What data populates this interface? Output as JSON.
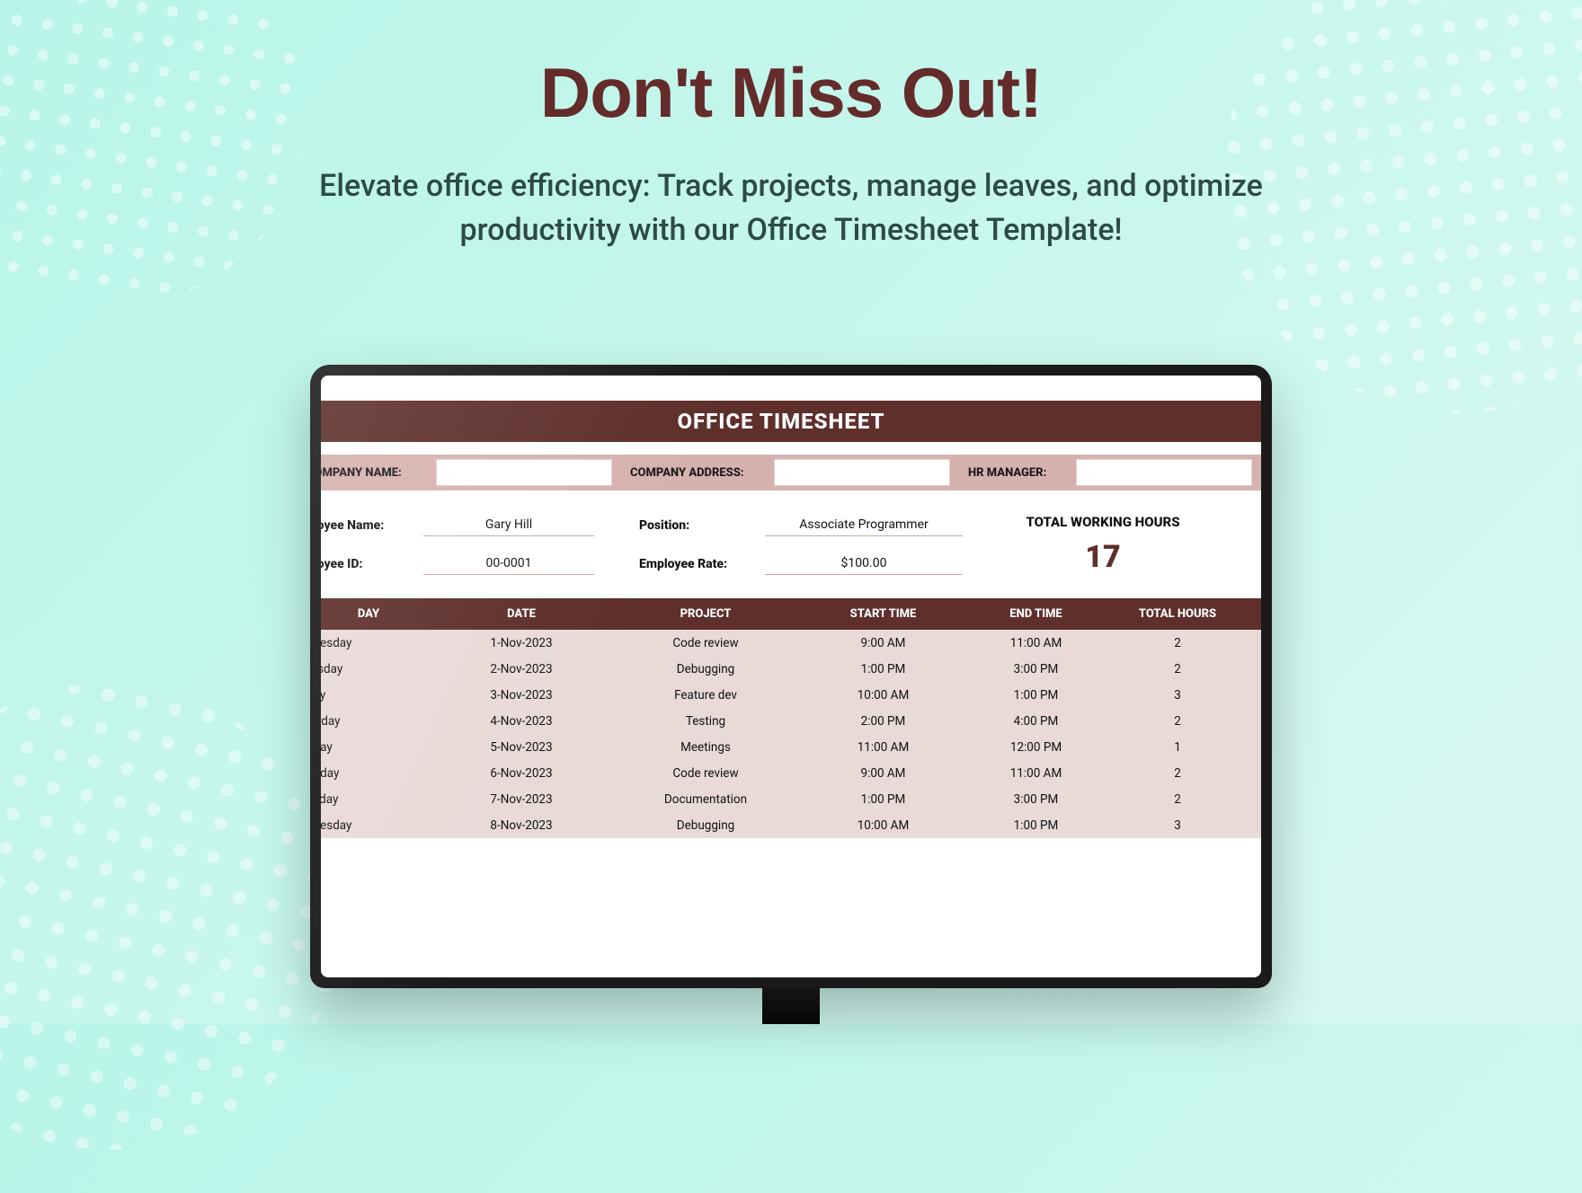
{
  "hero": {
    "headline": "Don't Miss Out!",
    "subhead": "Elevate office efficiency: Track projects, manage leaves, and optimize productivity with our Office Timesheet Template!"
  },
  "sheet": {
    "title": "OFFICE TIMESHEET",
    "meta": {
      "company_name_label": "COMPANY NAME:",
      "company_address_label": "COMPANY ADDRESS:",
      "hr_manager_label": "HR MANAGER:"
    },
    "employee": {
      "name_label": "ployee Name:",
      "name_value": "Gary Hill",
      "position_label": "Position:",
      "position_value": "Associate Programmer",
      "id_label": "ployee ID:",
      "id_value": "00-0001",
      "rate_label": "Employee Rate:",
      "rate_value": "$100.00",
      "twh_label": "TOTAL WORKING HOURS",
      "twh_value": "17"
    },
    "columns": {
      "day": "DAY",
      "date": "DATE",
      "project": "PROJECT",
      "start": "START TIME",
      "end": "END TIME",
      "total": "TOTAL HOURS"
    },
    "rows": [
      {
        "day": "dnesday",
        "date": "1-Nov-2023",
        "project": "Code review",
        "start": "9:00 AM",
        "end": "11:00 AM",
        "total": "2"
      },
      {
        "day": "ursday",
        "date": "2-Nov-2023",
        "project": "Debugging",
        "start": "1:00 PM",
        "end": "3:00 PM",
        "total": "2"
      },
      {
        "day": "day",
        "date": "3-Nov-2023",
        "project": "Feature dev",
        "start": "10:00 AM",
        "end": "1:00 PM",
        "total": "3"
      },
      {
        "day": "turday",
        "date": "4-Nov-2023",
        "project": "Testing",
        "start": "2:00 PM",
        "end": "4:00 PM",
        "total": "2"
      },
      {
        "day": "nday",
        "date": "5-Nov-2023",
        "project": "Meetings",
        "start": "11:00 AM",
        "end": "12:00 PM",
        "total": "1"
      },
      {
        "day": "onday",
        "date": "6-Nov-2023",
        "project": "Code review",
        "start": "9:00 AM",
        "end": "11:00 AM",
        "total": "2"
      },
      {
        "day": "esday",
        "date": "7-Nov-2023",
        "project": "Documentation",
        "start": "1:00 PM",
        "end": "3:00 PM",
        "total": "2"
      },
      {
        "day": "dnesday",
        "date": "8-Nov-2023",
        "project": "Debugging",
        "start": "10:00 AM",
        "end": "1:00 PM",
        "total": "3"
      }
    ]
  }
}
